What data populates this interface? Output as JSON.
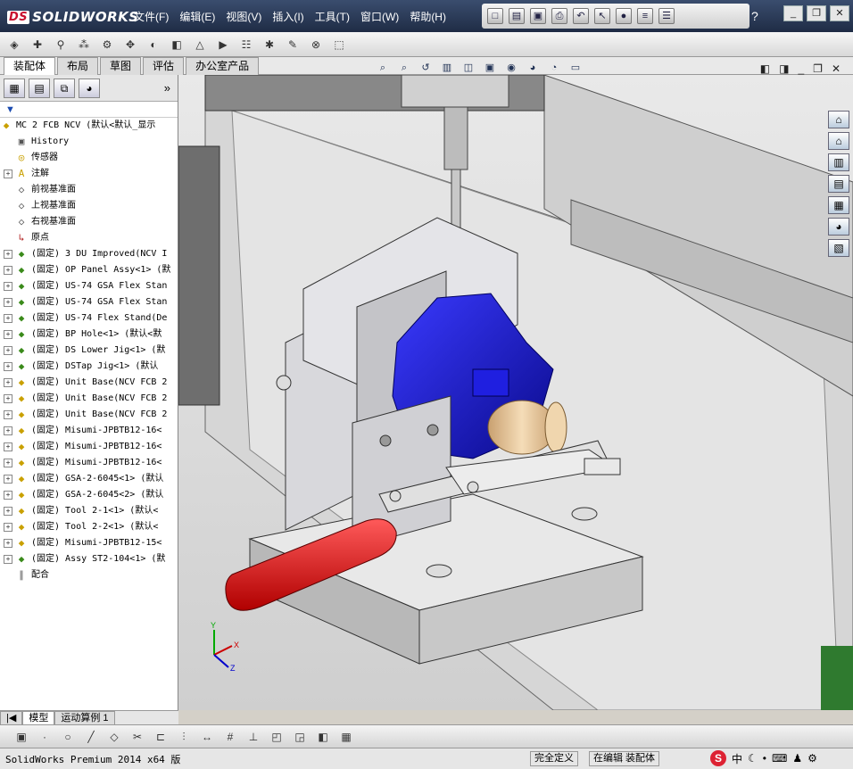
{
  "app": {
    "logo": "SOLIDWORKS",
    "logo_prefix": "DS"
  },
  "menu": [
    "文件(F)",
    "编辑(E)",
    "视图(V)",
    "插入(I)",
    "工具(T)",
    "窗口(W)",
    "帮助(H)"
  ],
  "tabs": [
    "装配体",
    "布局",
    "草图",
    "评估",
    "办公室产品"
  ],
  "feature_tree": {
    "root": "MC 2 FCB NCV  (默认<默认_显示",
    "items": [
      {
        "label": "History",
        "icon": "history-icon",
        "expand": false
      },
      {
        "label": "传感器",
        "icon": "sensor-icon",
        "expand": false
      },
      {
        "label": "注解",
        "icon": "annotation-icon",
        "expand": true
      },
      {
        "label": "前视基准面",
        "icon": "plane-icon",
        "expand": false
      },
      {
        "label": "上视基准面",
        "icon": "plane-icon",
        "expand": false
      },
      {
        "label": "右视基准面",
        "icon": "plane-icon",
        "expand": false
      },
      {
        "label": "原点",
        "icon": "origin-icon",
        "expand": false
      },
      {
        "label": "(固定) 3 DU Improved(NCV I",
        "icon": "subassembly-icon",
        "expand": true
      },
      {
        "label": "(固定) OP Panel Assy<1> (默",
        "icon": "subassembly-icon",
        "expand": true
      },
      {
        "label": "(固定) US-74 GSA Flex Stan",
        "icon": "subassembly-icon",
        "expand": true
      },
      {
        "label": "(固定) US-74 GSA Flex Stan",
        "icon": "subassembly-icon",
        "expand": true
      },
      {
        "label": "(固定) US-74 Flex Stand(De",
        "icon": "subassembly-icon",
        "expand": true
      },
      {
        "label": "(固定) BP Hole<1> (默认<默",
        "icon": "subassembly-icon",
        "expand": true
      },
      {
        "label": "(固定) DS Lower Jig<1> (默",
        "icon": "subassembly-icon",
        "expand": true
      },
      {
        "label": "(固定) DSTap Jig<1> (默认",
        "icon": "subassembly-icon",
        "expand": true
      },
      {
        "label": "(固定) Unit Base(NCV FCB 2",
        "icon": "part-icon",
        "expand": true
      },
      {
        "label": "(固定) Unit Base(NCV FCB 2",
        "icon": "part-icon",
        "expand": true
      },
      {
        "label": "(固定) Unit Base(NCV FCB 2",
        "icon": "part-icon",
        "expand": true
      },
      {
        "label": "(固定) Misumi-JPBTB12-16<",
        "icon": "part-icon",
        "expand": true
      },
      {
        "label": "(固定) Misumi-JPBTB12-16<",
        "icon": "part-icon",
        "expand": true
      },
      {
        "label": "(固定) Misumi-JPBTB12-16<",
        "icon": "part-icon",
        "expand": true
      },
      {
        "label": "(固定) GSA-2-6045<1> (默认",
        "icon": "part-icon",
        "expand": true
      },
      {
        "label": "(固定) GSA-2-6045<2> (默认",
        "icon": "part-icon",
        "expand": true
      },
      {
        "label": "(固定) Tool 2-1<1> (默认<",
        "icon": "part-icon",
        "expand": true
      },
      {
        "label": "(固定) Tool 2-2<1> (默认<",
        "icon": "part-icon",
        "expand": true
      },
      {
        "label": "(固定) Misumi-JPBTB12-15<",
        "icon": "part-icon",
        "expand": true
      },
      {
        "label": "(固定) Assy ST2-104<1> (默",
        "icon": "subassembly-icon",
        "expand": true
      },
      {
        "label": "配合",
        "icon": "mates-icon",
        "expand": false
      }
    ]
  },
  "bottom_tabs": [
    "模型",
    "运动算例 1"
  ],
  "status": {
    "left": "SolidWorks Premium 2014 x64 版",
    "defined": "完全定义",
    "editing": "在编辑 装配体"
  },
  "ime": {
    "brand": "S",
    "mode": "中"
  },
  "triad": {
    "x": "X",
    "y": "Y",
    "z": "Z"
  },
  "colors": {
    "handle": "#e01010",
    "part_blue": "#1a1ad0",
    "roller": "#e8c89a",
    "base_gray": "#d8d8dc"
  }
}
